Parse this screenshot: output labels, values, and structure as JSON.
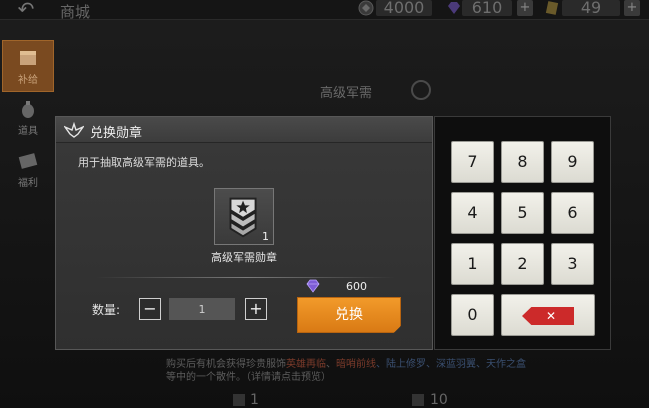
{
  "background": {
    "shop_title": "商城",
    "currencies": [
      {
        "icon": "medal-coin-icon",
        "value": "4000"
      },
      {
        "icon": "purple-gem-icon",
        "value": "610"
      },
      {
        "icon": "gold-ticket-icon",
        "value": "49"
      }
    ],
    "side_tabs": [
      {
        "label": "补给",
        "icon": "supply-crate-icon",
        "active": true
      },
      {
        "label": "道具",
        "icon": "grenade-icon",
        "active": false
      },
      {
        "label": "福利",
        "icon": "gift-ticket-icon",
        "active": false
      }
    ],
    "item_title": "高级军需",
    "info_prefix": "购买后有机会获得珍贵服饰",
    "info_hl_1": "英雄再临",
    "info_sep_1": "、",
    "info_hl_2": "暗哨前线",
    "info_rest": "、陆上修罗、深蓝羽翼、天作之盒",
    "info_line2": "等中的一个散件。（详情请点击预览）",
    "bottom_count_a": "1",
    "bottom_count_b": "10"
  },
  "modal": {
    "title": "兑换勋章",
    "description": "用于抽取高级军需的道具。",
    "item": {
      "name": "高级军需勋章",
      "count": "1",
      "icon": "military-badge-icon"
    },
    "price": {
      "icon": "purple-gem-icon",
      "value": "600"
    },
    "quantity_label": "数量:",
    "quantity_value": "1",
    "minus_label": "−",
    "plus_label": "+",
    "redeem_label": "兑换"
  },
  "keypad": {
    "keys": [
      "7",
      "8",
      "9",
      "4",
      "5",
      "6",
      "1",
      "2",
      "3",
      "0"
    ],
    "delete_icon": "backspace-icon",
    "delete_glyph": "✕",
    "delete_color": "#cc2a2a"
  },
  "colors": {
    "accent_orange": "#f29a2a",
    "active_tab": "#7a4a20"
  }
}
